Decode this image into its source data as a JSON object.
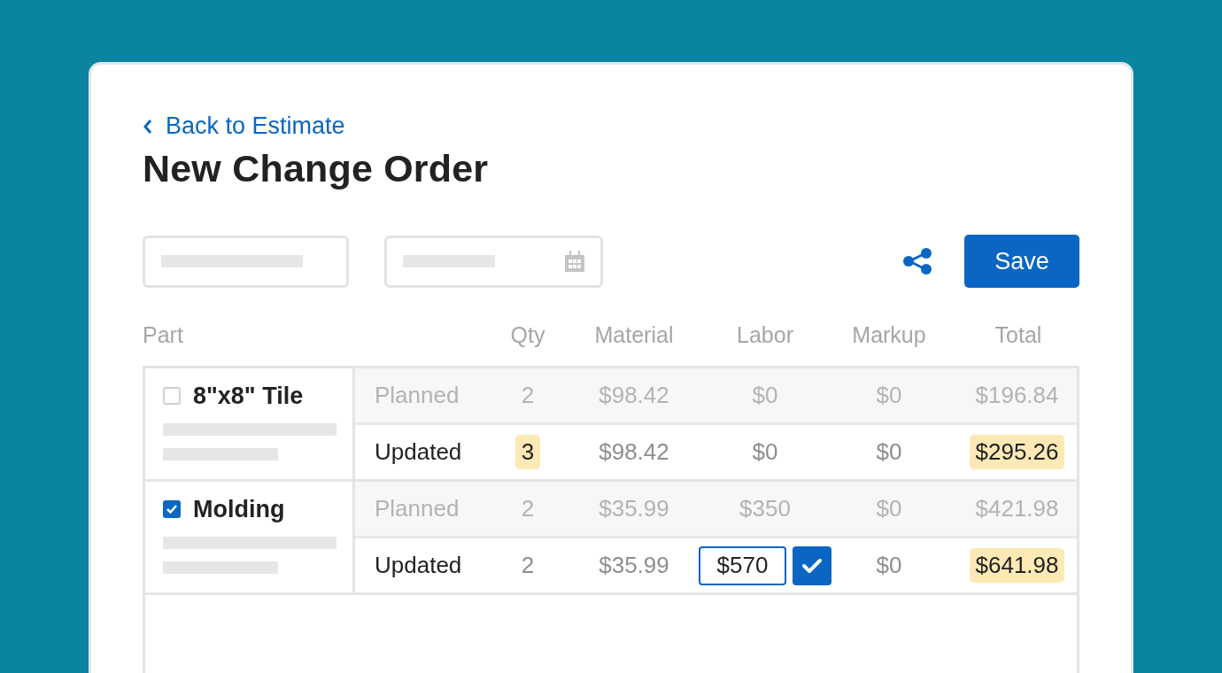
{
  "back_link": {
    "label": "Back to Estimate"
  },
  "title": "New Change Order",
  "toolbar": {
    "save_button": "Save"
  },
  "table": {
    "columns": [
      "Part",
      "Qty",
      "Material",
      "Labor",
      "Markup",
      "Total"
    ],
    "items": [
      {
        "name": "8\"x8\" Tile",
        "checked": false,
        "rows": [
          {
            "kind": "planned",
            "label": "Planned",
            "cells": [
              {
                "text": "2",
                "highlight": false
              },
              {
                "text": "$98.42",
                "highlight": false
              },
              {
                "text": "$0",
                "highlight": false
              },
              {
                "text": "$0",
                "highlight": false
              },
              {
                "text": "$196.84",
                "highlight": false
              }
            ]
          },
          {
            "kind": "updated",
            "label": "Updated",
            "cells": [
              {
                "text": "3",
                "highlight": true
              },
              {
                "text": "$98.42",
                "highlight": false
              },
              {
                "text": "$0",
                "highlight": false
              },
              {
                "text": "$0",
                "highlight": false
              },
              {
                "text": "$295.26",
                "highlight": true
              }
            ]
          }
        ]
      },
      {
        "name": "Molding",
        "checked": true,
        "rows": [
          {
            "kind": "planned",
            "label": "Planned",
            "cells": [
              {
                "text": "2",
                "highlight": false
              },
              {
                "text": "$35.99",
                "highlight": false
              },
              {
                "text": "$350",
                "highlight": false
              },
              {
                "text": "$0",
                "highlight": false
              },
              {
                "text": "$421.98",
                "highlight": false
              }
            ]
          },
          {
            "kind": "updated",
            "label": "Updated",
            "cells": [
              {
                "text": "2",
                "highlight": false
              },
              {
                "text": "$35.99",
                "highlight": false
              },
              {
                "text": "$570",
                "highlight": false,
                "kind": "editing"
              },
              {
                "text": "$0",
                "highlight": false
              },
              {
                "text": "$641.98",
                "highlight": true
              }
            ]
          }
        ]
      }
    ]
  }
}
